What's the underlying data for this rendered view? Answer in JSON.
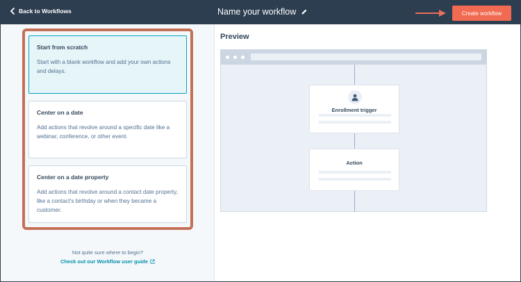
{
  "header": {
    "back_label": "Back to Workflows",
    "workflow_title": "Name your workflow",
    "create_button": "Create workflow"
  },
  "options": [
    {
      "title": "Start from scratch",
      "description": "Start with a blank workflow and add your own actions and delays.",
      "selected": true
    },
    {
      "title": "Center on a date",
      "description": "Add actions that revolve around a specific date like a webinar, conference, or other event.",
      "selected": false
    },
    {
      "title": "Center on a date property",
      "description": "Add actions that revolve around a contact date property, like a contact's birthday or when they became a customer.",
      "selected": false
    }
  ],
  "help": {
    "prompt": "Not quite sure where to begin?",
    "link": "Check out our Workflow user guide"
  },
  "preview": {
    "title": "Preview",
    "trigger_label": "Enrollment trigger",
    "action_label": "Action"
  },
  "colors": {
    "topbar": "#2d3e50",
    "create_button": "#f16a52",
    "selected_card_border": "#00a4bd",
    "selected_card_bg": "#e5f5f8",
    "highlight_frame": "#c47057",
    "link": "#0091ae"
  },
  "icons": {
    "back": "chevron-left-icon",
    "edit": "pencil-icon",
    "annotation": "arrow-right-icon",
    "external": "external-link-icon",
    "contact": "user-icon"
  }
}
